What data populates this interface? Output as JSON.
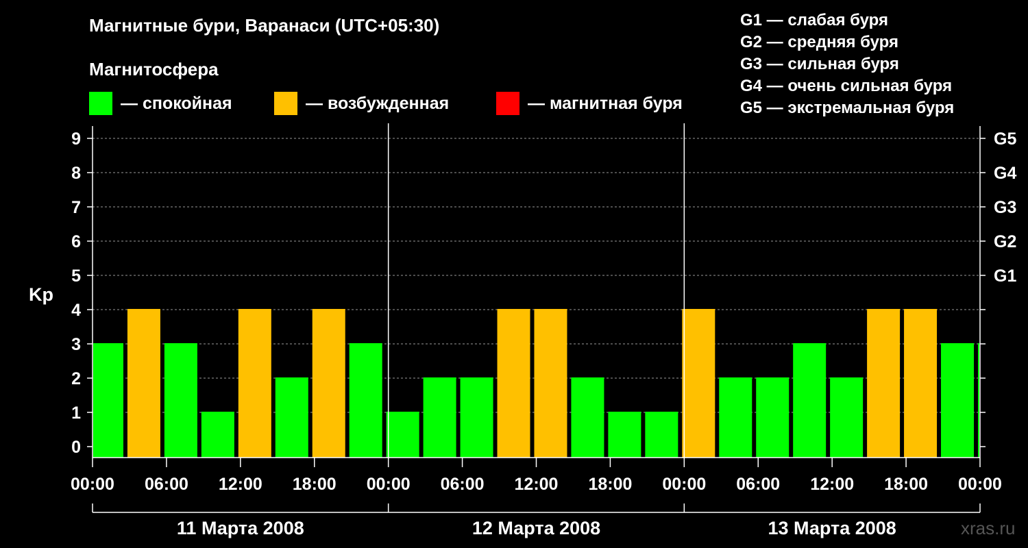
{
  "title": "Магнитные бури, Варанаси (UTC+05:30)",
  "subtitle": "Магнитосфера",
  "legend": [
    {
      "label": "— спокойная",
      "color": "#00ff00"
    },
    {
      "label": "— возбужденная",
      "color": "#ffc000"
    },
    {
      "label": "— магнитная буря",
      "color": "#ff0000"
    }
  ],
  "g_scale": [
    "G1 — слабая буря",
    "G2 — средняя буря",
    "G3 — сильная буря",
    "G4 — очень сильная буря",
    "G5 — экстремальная буря"
  ],
  "watermark": "xras.ru",
  "chart_data": {
    "type": "bar",
    "ylabel": "Kp",
    "ylim": [
      0,
      9
    ],
    "yticks": [
      0,
      1,
      2,
      3,
      4,
      5,
      6,
      7,
      8,
      9
    ],
    "right_ticks": [
      {
        "value": 5,
        "label": "G1"
      },
      {
        "value": 6,
        "label": "G2"
      },
      {
        "value": 7,
        "label": "G3"
      },
      {
        "value": 8,
        "label": "G4"
      },
      {
        "value": 9,
        "label": "G5"
      }
    ],
    "x_tick_labels": [
      "00:00",
      "06:00",
      "12:00",
      "18:00",
      "00:00",
      "06:00",
      "12:00",
      "18:00",
      "00:00",
      "06:00",
      "12:00",
      "18:00",
      "00:00"
    ],
    "days": [
      "11 Марта 2008",
      "12 Марта 2008",
      "13 Марта 2008"
    ],
    "grid": "dashed horizontal",
    "colors": {
      "quiet": "#00ff00",
      "active": "#ffc000",
      "storm": "#ff0000"
    },
    "values": [
      3,
      4,
      3,
      1,
      4,
      2,
      4,
      3,
      1,
      2,
      2,
      4,
      4,
      2,
      1,
      1,
      4,
      2,
      2,
      3,
      2,
      4,
      4,
      3,
      3
    ]
  }
}
